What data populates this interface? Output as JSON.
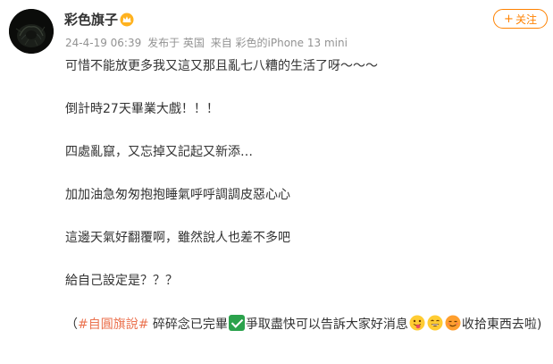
{
  "user": {
    "name": "彩色旗子"
  },
  "meta": {
    "time": "24-4-19 06:39",
    "location": "发布于 英国",
    "source": "来自 彩色的iPhone 13 mini"
  },
  "follow": {
    "plus": "+",
    "label": "关注"
  },
  "post": {
    "paragraphs": [
      "可惜不能放更多我又這又那且亂七八糟的生活了呀～～～",
      "倒計時27天畢業大戲！！！",
      "四處亂竄，又忘掉又記起又新添…",
      "加加油急匆匆抱抱睡氣呼呼調調皮惡心心",
      "這邊天氣好翻覆啊，雖然說人也差不多吧",
      "給自己設定是？？？"
    ],
    "final": {
      "hashtag": "#自圓旗說#",
      "text_before_check": " 碎碎念已完畢",
      "text_after_check": "爭取盡快可以告訴大家好消息",
      "text_end": "收拾東西去啦)",
      "open_paren": "（"
    }
  },
  "icons": {
    "vip": "crown-icon",
    "check": "white-heavy-check-mark",
    "emoji_1": "tongue-out-emoji",
    "emoji_2": "grinning-emoji",
    "emoji_3": "smirk-emoji"
  },
  "colors": {
    "accent": "#ff8200",
    "hashtag": "#eb7350",
    "meta": "#939393",
    "text": "#333333"
  }
}
